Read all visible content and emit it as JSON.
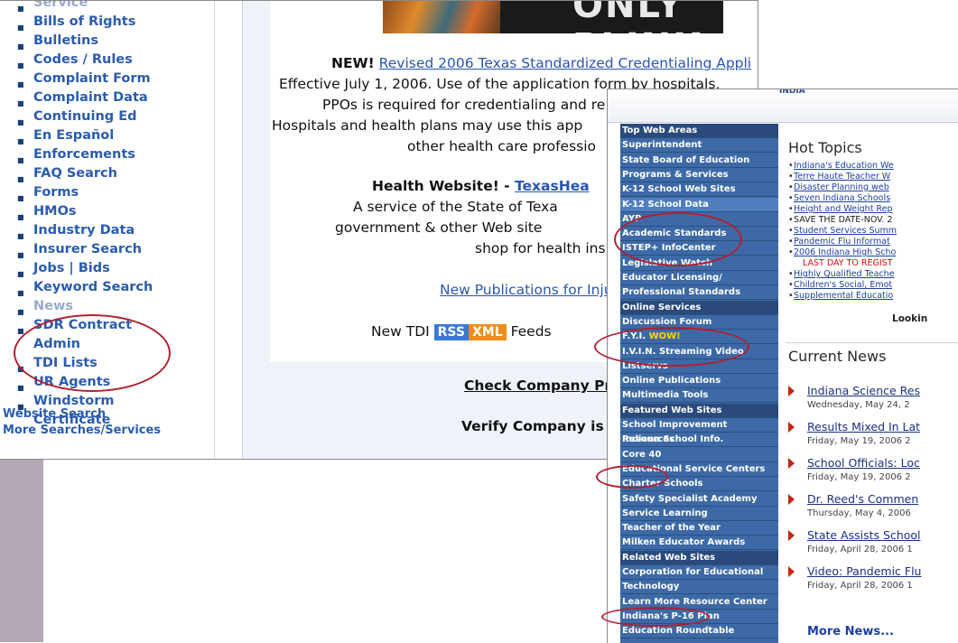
{
  "texas": {
    "sidebar_items": [
      {
        "label": "Service",
        "cut": true
      },
      {
        "label": "Bills of Rights"
      },
      {
        "label": "Bulletins"
      },
      {
        "label": "Codes / Rules"
      },
      {
        "label": "Complaint Form"
      },
      {
        "label": "Complaint Data"
      },
      {
        "label": "Continuing Ed"
      },
      {
        "label": "En Español"
      },
      {
        "label": "Enforcements"
      },
      {
        "label": "FAQ Search"
      },
      {
        "label": "Forms"
      },
      {
        "label": "HMOs"
      },
      {
        "label": "Industry Data"
      },
      {
        "label": "Insurer Search"
      },
      {
        "label": "Jobs | Bids"
      },
      {
        "label": "Keyword Search"
      },
      {
        "label": "News",
        "cut": true
      },
      {
        "label": "SDR Contract Admin",
        "wrap": true
      },
      {
        "label": "TDI Lists"
      },
      {
        "label": "UR Agents"
      },
      {
        "label": "Windstorm Certificate",
        "wrap": true
      }
    ],
    "website_search": "Website Search",
    "more_searches": "More Searches/Services",
    "banner_text": "ONLY PLINK",
    "new_label": "NEW!",
    "new_link": "Revised 2006 Texas Standardized Credentialing Appli",
    "para_line1": "Effective July 1, 2006. Use of the application form by hospitals,",
    "para_line2": "PPOs is required for credentialing and re",
    "para_line3": "Hospitals and health plans may use this app",
    "para_line4": "other health care professio",
    "health_label": "Health Website! - ",
    "health_link": "TexasHea",
    "service_line1": "A service of the State of Texa",
    "service_line2": "government & other Web site",
    "service_line3": "shop for health insu",
    "publications_link": "New Publications for Inju",
    "tdi_prefix": "New TDI",
    "rss": "RSS",
    "xml": "XML",
    "feeds": "Feeds",
    "check_company": "Check Company Pr",
    "verify_company": "Verify Company is Licens"
  },
  "indiana": {
    "topbar_text": "INDIA",
    "nav": [
      {
        "label": "Top Web Areas",
        "kind": "header"
      },
      {
        "label": "Superintendent"
      },
      {
        "label": "State Board of Education"
      },
      {
        "label": "Programs & Services"
      },
      {
        "label": "K-12 School Web Sites"
      },
      {
        "label": "K-12 School Data"
      },
      {
        "label": "AYP"
      },
      {
        "label": "Academic Standards"
      },
      {
        "label": "ISTEP+ InfoCenter"
      },
      {
        "label": "Legislative Watch"
      },
      {
        "label": "Educator Licensing/"
      },
      {
        "label": "Professional Standards"
      },
      {
        "label": "Online Services",
        "kind": "header"
      },
      {
        "label": "Discussion Forum"
      },
      {
        "label": "F.Y.I.",
        "extra": "WOW!"
      },
      {
        "label": "I.V.I.N. Streaming Video"
      },
      {
        "label": "Listservs"
      },
      {
        "label": "Online Publications"
      },
      {
        "label": "Multimedia Tools"
      },
      {
        "label": "Featured Web Sites",
        "kind": "header"
      },
      {
        "label": "School Improvement Resources"
      },
      {
        "label": "Indiana School Info."
      },
      {
        "label": "Core 40"
      },
      {
        "label": "Educational Service Centers"
      },
      {
        "label": "Charter Schools"
      },
      {
        "label": "Safety Specialist Academy"
      },
      {
        "label": "Service Learning"
      },
      {
        "label": "Teacher of the Year"
      },
      {
        "label": "Milken Educator Awards"
      },
      {
        "label": "Related Web Sites",
        "kind": "header"
      },
      {
        "label": "Corporation for Educational"
      },
      {
        "label": "Technology"
      },
      {
        "label": "Learn More Resource Center"
      },
      {
        "label": "Indiana's P-16 Plan"
      },
      {
        "label": "Education Roundtable"
      }
    ],
    "hot_topics_title": "Hot Topics",
    "hot_topics": [
      {
        "text": "Indiana's Education We"
      },
      {
        "text": "Terre Haute Teacher W"
      },
      {
        "text": "Disaster Planning web"
      },
      {
        "text": "Seven Indiana Schools"
      },
      {
        "text": "Height and Weight Rep"
      },
      {
        "text": "SAVE THE DATE-NOV. 2",
        "kind": "plain"
      },
      {
        "text": "Student Services Summ"
      },
      {
        "text": "Pandemic Flu Informat"
      },
      {
        "text": "2006 Indiana High Scho"
      },
      {
        "text": "LAST DAY TO REGIST",
        "kind": "red"
      },
      {
        "text": "Highly Qualified Teache"
      },
      {
        "text": "Children's Social, Emot"
      },
      {
        "text": "Supplemental Educatio"
      }
    ],
    "looking": "Lookin",
    "current_news_title": "Current News",
    "news": [
      {
        "title": "Indiana Science Res",
        "date": "Wednesday, May 24, 2"
      },
      {
        "title": "Results Mixed In Lat",
        "date": "Friday, May 19, 2006 2"
      },
      {
        "title": "School Officials: Loc",
        "date": "Friday, May 19, 2006 2"
      },
      {
        "title": "Dr. Reed's Commen",
        "date": "Thursday, May 4, 2006"
      },
      {
        "title": "State Assists School",
        "date": "Friday, April 28, 2006 1"
      },
      {
        "title": "Video: Pandemic Flu",
        "date": "Friday, April 28, 2006 1"
      }
    ],
    "more_news": "More News..."
  },
  "colors": {
    "annotation": "#b3202f",
    "tx_link": "#2b5cae",
    "in_nav": "#3d6aa6",
    "in_nav_header": "#2a4a7c",
    "mauve_strip": "#b3a6b5"
  }
}
